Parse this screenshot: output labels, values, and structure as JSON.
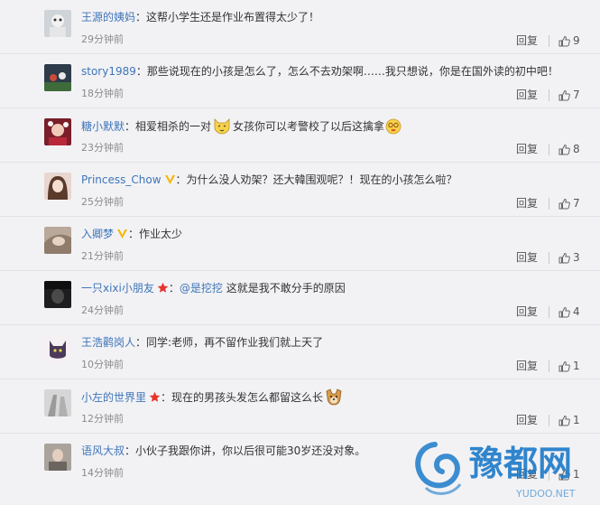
{
  "ui": {
    "reply_label": "回复"
  },
  "comments": [
    {
      "user": "王源的姨妈",
      "sep": "：",
      "text": "这帮小学生还是作业布置得太少了！",
      "time": "29分钟前",
      "likes": "9"
    },
    {
      "user": "story1989",
      "sep": "：",
      "text": "那些说现在的小孩是怎么了，怎么不去劝架啊……我只想说，你是在国外读的初中吧！",
      "time": "18分钟前",
      "likes": "7"
    },
    {
      "user": "糖小默默",
      "sep": "：",
      "text_a": "相爱相杀的一对",
      "text_b": "女孩你可以考警校了以后这擒拿",
      "time": "23分钟前",
      "likes": "8"
    },
    {
      "user": "Princess_Chow",
      "sep": "：",
      "text": "为什么没人劝架？还大韓围观呢？！现在的小孩怎么啦？",
      "time": "25分钟前",
      "likes": "7"
    },
    {
      "user": "入卿梦",
      "sep": "：",
      "text": "作业太少",
      "time": "21分钟前",
      "likes": "3"
    },
    {
      "user": "一只xixi小朋友",
      "sep": "：",
      "mention": "@是挖挖",
      "text": "这就是我不敢分手的原因",
      "time": "24分钟前",
      "likes": "4"
    },
    {
      "user": "王浩鹳岗人",
      "sep": "：",
      "text": "同学:老师，再不留作业我们就上天了",
      "time": "10分钟前",
      "likes": "1"
    },
    {
      "user": "小左的世界里",
      "sep": "：",
      "text": "现在的男孩头发怎么都留这么长",
      "time": "12分钟前",
      "likes": "1"
    },
    {
      "user": "语风大叔",
      "sep": "：",
      "text": "小伙子我跟你讲，你以后很可能30岁还没对象。",
      "time": "14分钟前",
      "likes": "1"
    }
  ],
  "watermark": {
    "brand": "豫都网",
    "domain": "YUDOO.NET"
  },
  "colors": {
    "username": "#3f75b8",
    "background": "#f2f2f5",
    "vip_badge": "#f5b500",
    "star_badge": "#e8342b",
    "watermark_blue": "#1c7ac9"
  },
  "icons": [
    "thumb-up-icon",
    "vip-badge-icon",
    "star-badge-icon",
    "cat-emoji-icon",
    "dizzy-emoji-icon",
    "dog-emoji-icon"
  ]
}
